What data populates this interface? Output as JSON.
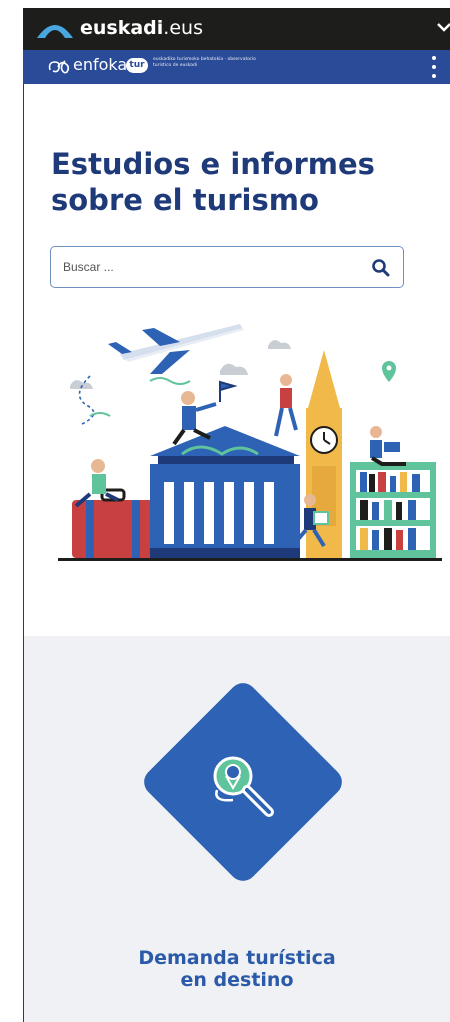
{
  "gov_bar": {
    "name_bold": "euskadi",
    "name_suffix": ".eus"
  },
  "brand_bar": {
    "logo_text": "enfoka",
    "logo_badge": "tur",
    "tagline": "euskadiko turismoko behatokia · observatorio turístico de euskadi"
  },
  "hero": {
    "title": "Estudios e informes sobre el turismo"
  },
  "search": {
    "placeholder": "Buscar ..."
  },
  "categories": [
    {
      "label": "Demanda turística en destino",
      "icon": "location-magnifier-icon"
    }
  ],
  "colors": {
    "gov_bar": "#1d1d1b",
    "brand_bar": "#2a4b97",
    "title": "#1f3a79",
    "category_diamond": "#2d62b4",
    "section_bg": "#f0f1f5"
  }
}
